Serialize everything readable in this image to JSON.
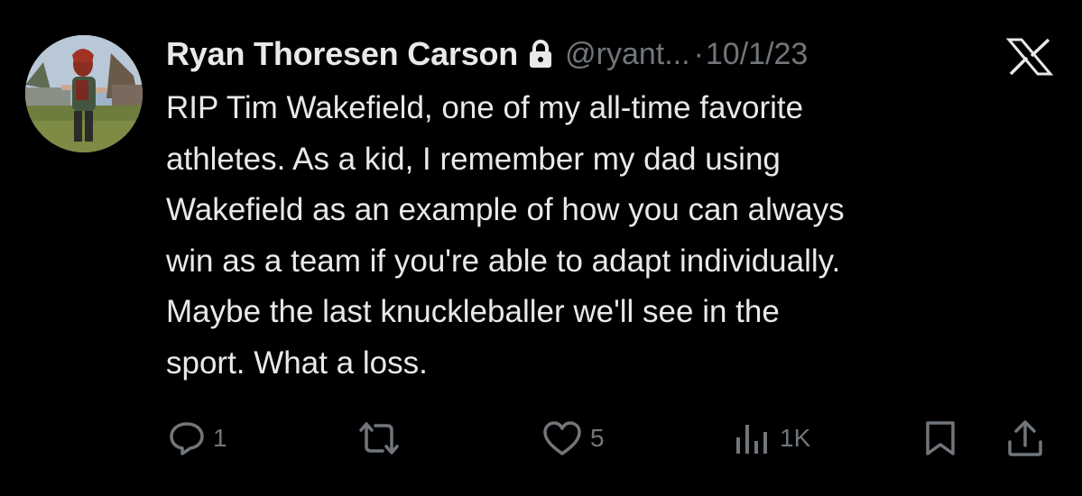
{
  "tweet": {
    "author_name": "Ryan Thoresen Carson",
    "handle": "@ryant...",
    "separator": "·",
    "date": "10/1/23",
    "lines": [
      "RIP Tim Wakefield, one of my all-time favorite",
      "athletes. As a kid, I remember my dad using",
      "Wakefield as an example of how you can always",
      "win as a team if you're able to adapt individually.",
      "Maybe the last knuckleballer we'll see in the",
      "sport. What a loss."
    ]
  },
  "actions": {
    "reply": {
      "icon": "reply-icon",
      "count": "1"
    },
    "repost": {
      "icon": "repost-icon",
      "count": ""
    },
    "like": {
      "icon": "heart-icon",
      "count": "5"
    },
    "views": {
      "icon": "views-icon",
      "count": "1K"
    },
    "bookmark": {
      "icon": "bookmark-icon"
    },
    "share": {
      "icon": "share-icon"
    }
  },
  "colors": {
    "background": "#000000",
    "primary_text": "#e7e9ea",
    "secondary_text": "#71767b"
  }
}
